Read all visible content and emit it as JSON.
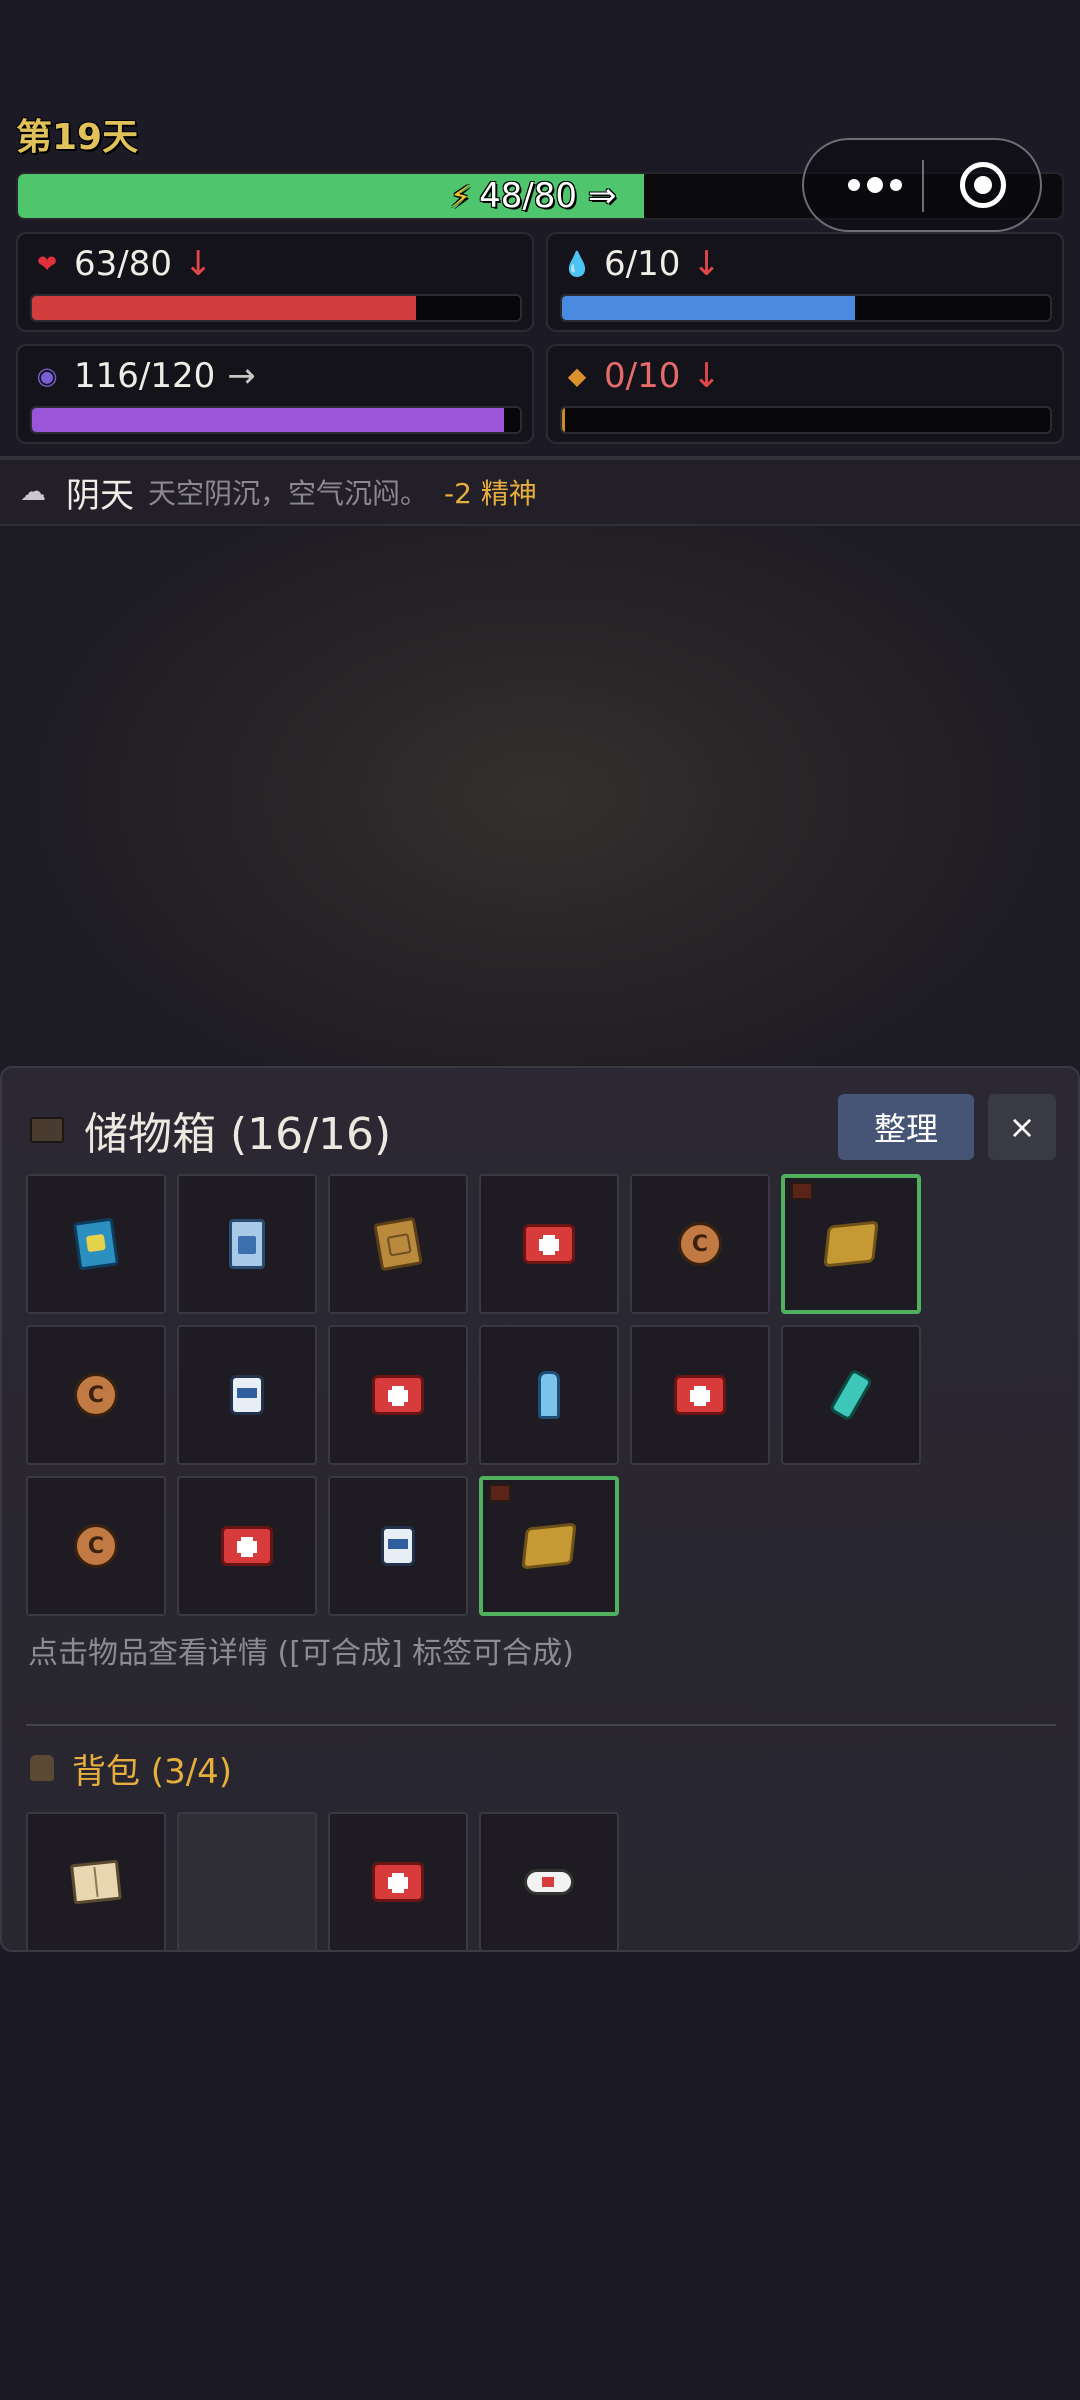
{
  "day_label": "第19天",
  "energy": {
    "text": "48/80 ⇒",
    "fraction": 0.6,
    "color": "#4fc56e"
  },
  "stats": [
    {
      "id": "health",
      "icon": "heart-icon",
      "glyph": "❤",
      "glyph_color": "#e0303c",
      "value": "63/80",
      "trend": "↓",
      "trend_kind": "down",
      "fraction": 0.7875,
      "color": "#d23e3e",
      "warn": false
    },
    {
      "id": "water",
      "icon": "water-drop-icon",
      "glyph": "💧",
      "glyph_color": "#2e9be0",
      "value": "6/10",
      "trend": "↓",
      "trend_kind": "down",
      "fraction": 0.6,
      "color": "#4a8be0",
      "warn": false
    },
    {
      "id": "sanity",
      "icon": "brain-icon",
      "glyph": "◉",
      "glyph_color": "#7b5fd6",
      "value": "116/120",
      "trend": "→",
      "trend_kind": "flat",
      "fraction": 0.9667,
      "color": "#9a55d8",
      "warn": false
    },
    {
      "id": "food",
      "icon": "bread-icon",
      "glyph": "◆",
      "glyph_color": "#d9932c",
      "value": "0/10",
      "trend": "↓",
      "trend_kind": "down",
      "fraction": 0.0,
      "color": "#c98a2c",
      "warn": true
    }
  ],
  "weather": {
    "icon": "cloud-icon",
    "title": "阴天",
    "desc": "天空阴沉，空气沉闷。",
    "effect": "-2 精神"
  },
  "storage": {
    "title": "储物箱 (16/16)",
    "sort_label": "整理",
    "close_label": "×",
    "items": [
      {
        "kind": "book",
        "name": "book-item",
        "craftable": false
      },
      {
        "kind": "milk",
        "name": "milk-carton-item",
        "craftable": false
      },
      {
        "kind": "book-old",
        "name": "old-book-item",
        "craftable": false
      },
      {
        "kind": "med",
        "name": "medkit-item",
        "craftable": false
      },
      {
        "kind": "coin",
        "name": "coin-item",
        "craftable": false
      },
      {
        "kind": "straw",
        "name": "straw-item",
        "craftable": true
      },
      {
        "kind": "coin",
        "name": "coin-item",
        "craftable": false
      },
      {
        "kind": "pills",
        "name": "pill-bottle-item",
        "craftable": false
      },
      {
        "kind": "med",
        "name": "medkit-item",
        "craftable": false
      },
      {
        "kind": "water",
        "name": "water-bottle-item",
        "craftable": false
      },
      {
        "kind": "med",
        "name": "medkit-item",
        "craftable": false
      },
      {
        "kind": "spray",
        "name": "spray-bottle-item",
        "craftable": false
      },
      {
        "kind": "coin",
        "name": "coin-item",
        "craftable": false
      },
      {
        "kind": "med",
        "name": "medkit-item",
        "craftable": false
      },
      {
        "kind": "pills",
        "name": "pill-bottle-item",
        "craftable": false
      },
      {
        "kind": "straw",
        "name": "straw-item",
        "craftable": true
      }
    ],
    "hint": "点击物品查看详情 ([可合成] 标签可合成)"
  },
  "backpack": {
    "title": "背包 (3/4)",
    "items": [
      {
        "kind": "map",
        "name": "map-item"
      },
      {
        "kind": "empty",
        "name": "empty-slot"
      },
      {
        "kind": "med",
        "name": "medkit-item"
      },
      {
        "kind": "bandage",
        "name": "bandage-item"
      }
    ]
  }
}
